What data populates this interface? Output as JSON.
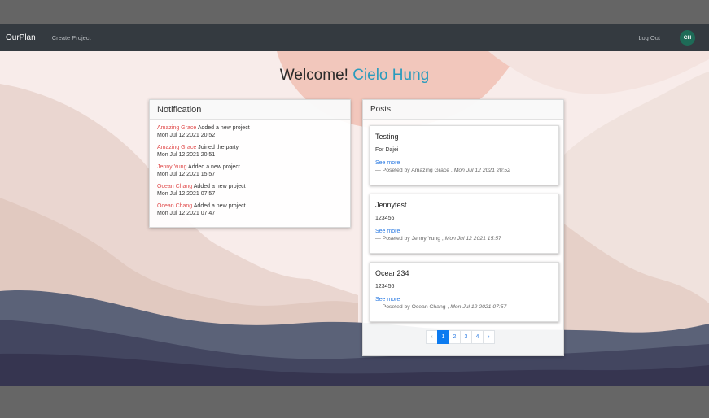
{
  "nav": {
    "brand": "OurPlan",
    "create_link": "Create Project",
    "logout": "Log Out",
    "avatar_initials": "CH"
  },
  "welcome": {
    "prefix": "Welcome!",
    "name": "Cielo Hung"
  },
  "notifications": {
    "title": "Notification",
    "items": [
      {
        "user": "Amazing Grace",
        "action": "Added a new project",
        "time": "Mon Jul 12 2021 20:52"
      },
      {
        "user": "Amazing Grace",
        "action": "Joined the party",
        "time": "Mon Jul 12 2021 20:51"
      },
      {
        "user": "Jenny Yung",
        "action": "Added a new project",
        "time": "Mon Jul 12 2021 15:57"
      },
      {
        "user": "Ocean Chang",
        "action": "Added a new project",
        "time": "Mon Jul 12 2021 07:57"
      },
      {
        "user": "Ocean Chang",
        "action": "Added a new project",
        "time": "Mon Jul 12 2021 07:47"
      }
    ]
  },
  "posts": {
    "title": "Posts",
    "see_more": "See more",
    "items": [
      {
        "title": "Testing",
        "body": "For Dajei",
        "footer": "— Poseted by Amazing Grace ,",
        "date": "Mon Jul 12 2021 20:52"
      },
      {
        "title": "Jennytest",
        "body": "123456",
        "footer": "— Poseted by Jenny Yung ,",
        "date": "Mon Jul 12 2021 15:57"
      },
      {
        "title": "Ocean234",
        "body": "123456",
        "footer": "— Poseted by Ocean Chang ,",
        "date": "Mon Jul 12 2021 07:57"
      }
    ]
  },
  "pagination": {
    "prev": "‹",
    "pages": [
      "1",
      "2",
      "3",
      "4"
    ],
    "active": "1",
    "next": "›"
  },
  "colors": {
    "navbar": "#343a40",
    "accent_name": "#2a9bbd",
    "user_link": "#e04b4b",
    "link": "#2a7ae2",
    "active_page": "#0d7bf0"
  }
}
